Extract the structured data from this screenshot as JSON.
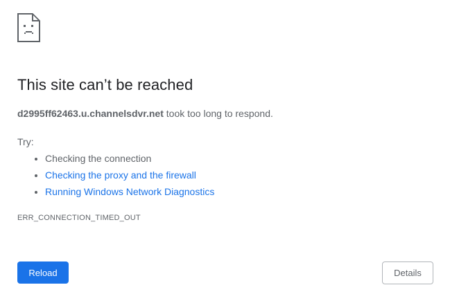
{
  "page": {
    "icon": "sad-page-icon",
    "heading": "This site can’t be reached",
    "host": "d2995ff62463.u.channelsdvr.net",
    "summary_suffix": " took too long to respond.",
    "try_label": "Try:",
    "suggestions": [
      {
        "label": "Checking the connection",
        "link": false
      },
      {
        "label": "Checking the proxy and the firewall",
        "link": true
      },
      {
        "label": "Running Windows Network Diagnostics",
        "link": true
      }
    ],
    "error_code": "ERR_CONNECTION_TIMED_OUT"
  },
  "buttons": {
    "reload_label": "Reload",
    "details_label": "Details"
  },
  "colors": {
    "heading": "#202124",
    "body_text": "#5f6368",
    "link": "#1a73e8",
    "primary_button": "#1a73e8"
  }
}
